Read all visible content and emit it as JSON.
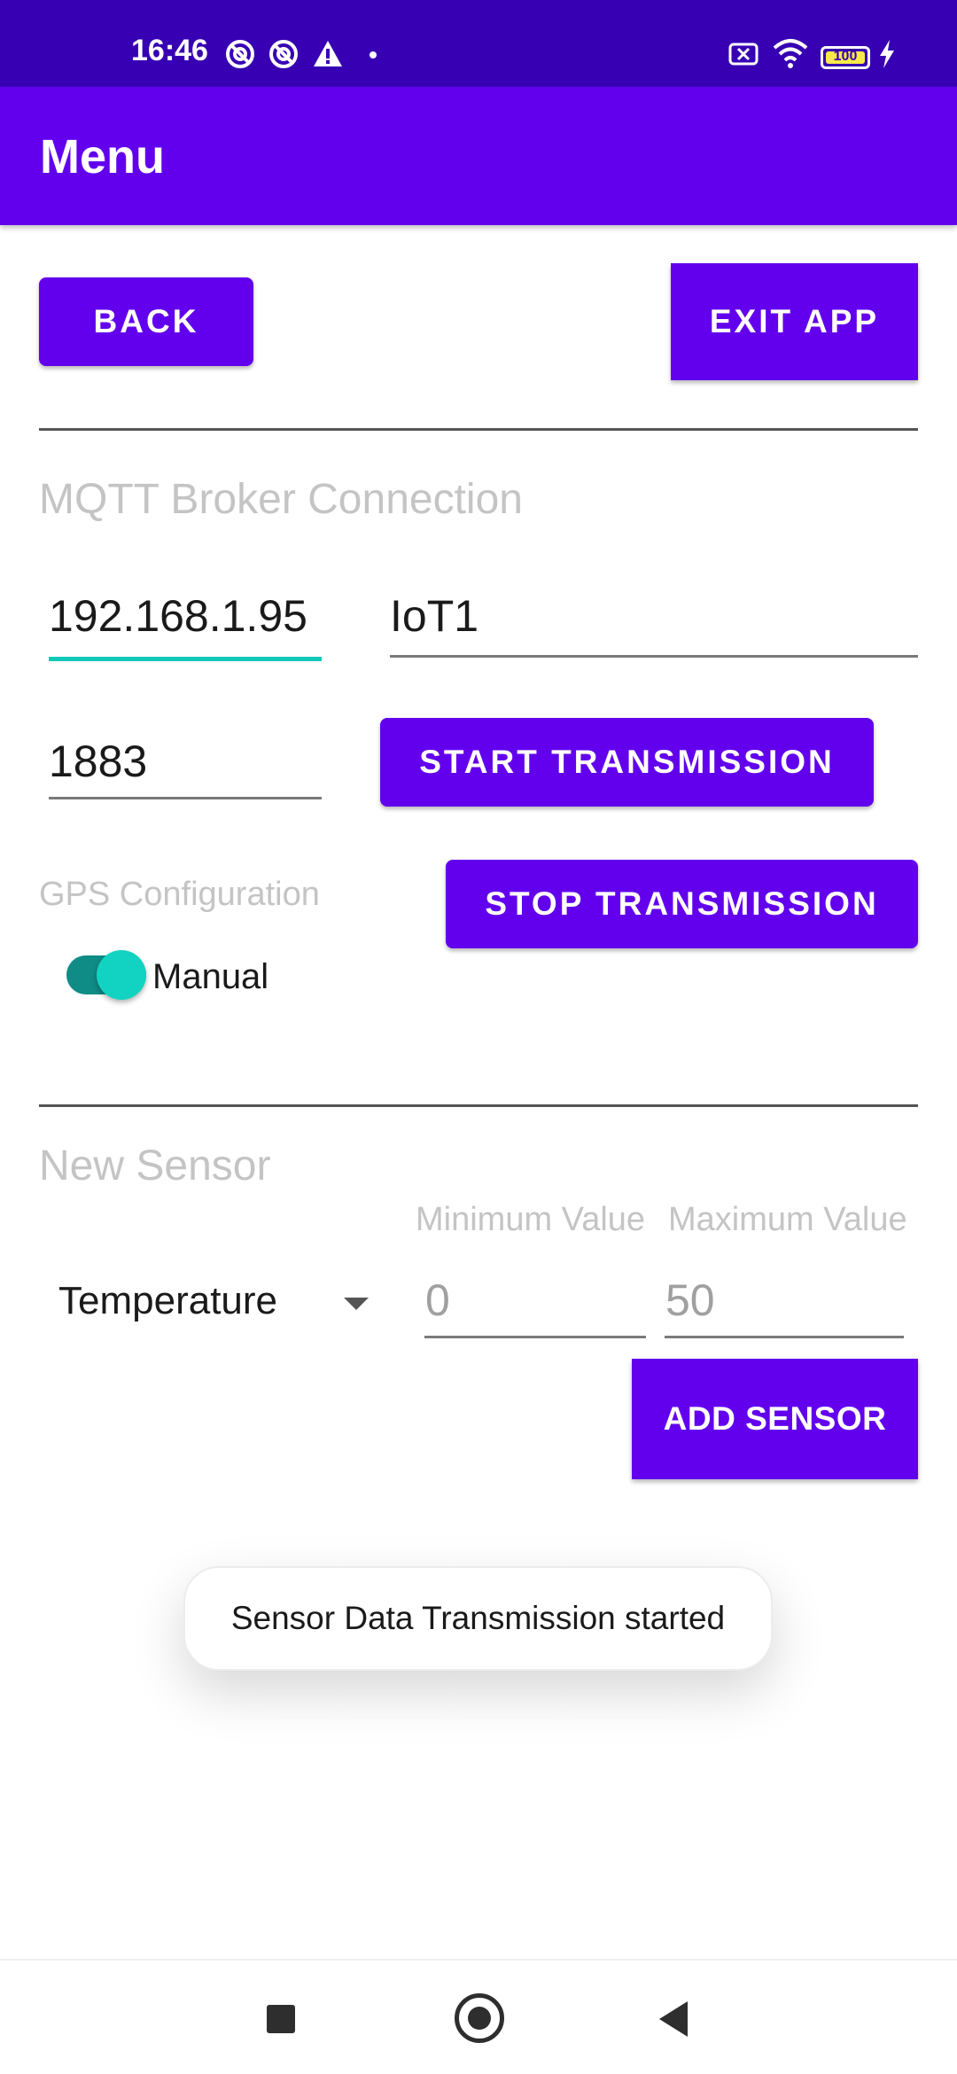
{
  "status_bar": {
    "time": "16:46",
    "battery_level": "100",
    "icons": [
      "at-sign-icon",
      "at-sign-icon",
      "warning-icon",
      "notification-dot-icon",
      "screen-cast-icon",
      "wifi-icon",
      "battery-icon",
      "charging-bolt-icon"
    ]
  },
  "app_bar": {
    "title": "Menu"
  },
  "top_actions": {
    "back_label": "BACK",
    "exit_label": "EXIT APP"
  },
  "mqtt": {
    "section_title": "MQTT Broker Connection",
    "host": "192.168.1.95",
    "client_id": "IoT1",
    "port": "1883",
    "start_label": "START TRANSMISSION",
    "stop_label": "STOP TRANSMISSION"
  },
  "gps": {
    "label": "GPS Configuration",
    "switch_label": "Manual",
    "switch_on": true
  },
  "new_sensor": {
    "section_title": "New Sensor",
    "min_label": "Minimum Value",
    "max_label": "Maximum Value",
    "sensor_type": "Temperature",
    "min_hint": "0",
    "max_hint": "50",
    "add_label": "ADD SENSOR"
  },
  "toast": {
    "message": "Sensor Data Transmission started"
  },
  "colors": {
    "status_bar": "#3700b3",
    "primary": "#6200ee",
    "accent": "#12c9b8",
    "hint_text": "#c4c4c4"
  }
}
